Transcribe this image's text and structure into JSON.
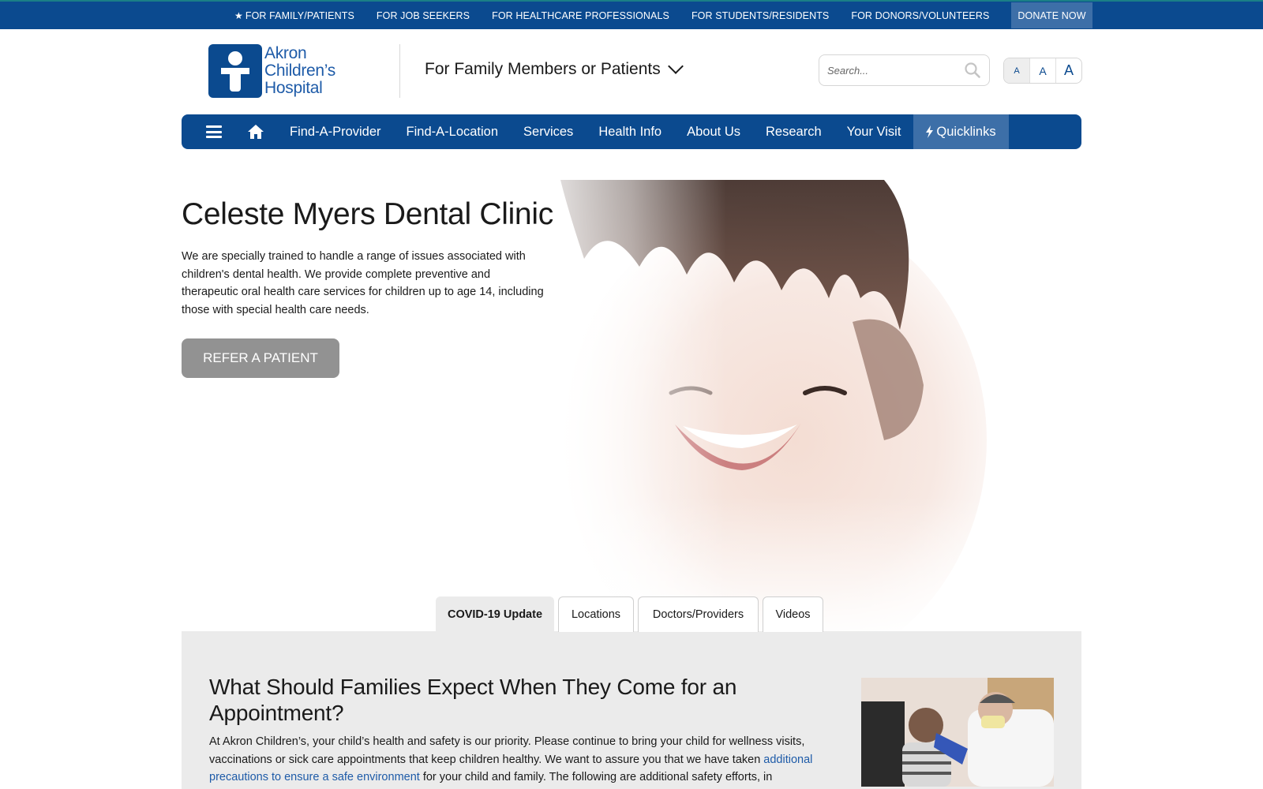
{
  "topbar": {
    "links": [
      {
        "label": "FOR FAMILY/PATIENTS"
      },
      {
        "label": "FOR JOB SEEKERS"
      },
      {
        "label": "FOR HEALTHCARE PROFESSIONALS"
      },
      {
        "label": "FOR STUDENTS/RESIDENTS"
      },
      {
        "label": "FOR DONORS/VOLUNTEERS"
      }
    ],
    "donate_label": "DONATE NOW"
  },
  "logo": {
    "line1": "Akron",
    "line2": "Children’s",
    "line3": "Hospital"
  },
  "audience_selector": {
    "label": "For Family Members or Patients"
  },
  "search": {
    "placeholder": "Search..."
  },
  "text_size": {
    "small": "A",
    "medium": "A",
    "large": "A"
  },
  "nav": {
    "items": [
      {
        "label": "Find-A-Provider"
      },
      {
        "label": "Find-A-Location"
      },
      {
        "label": "Services"
      },
      {
        "label": "Health Info"
      },
      {
        "label": "About Us"
      },
      {
        "label": "Research"
      },
      {
        "label": "Your Visit"
      }
    ],
    "quicklinks_label": "Quicklinks"
  },
  "hero": {
    "title": "Celeste Myers Dental Clinic",
    "description": "We are specially trained to handle a range of issues associated with children's dental health. We provide complete preventive and therapeutic oral health care services for children up to age 14, including those with special health care needs.",
    "cta_label": "REFER A PATIENT"
  },
  "tabs": [
    {
      "label": "COVID-19 Update",
      "active": true
    },
    {
      "label": "Locations",
      "active": false
    },
    {
      "label": "Doctors/Providers",
      "active": false
    },
    {
      "label": "Videos",
      "active": false
    }
  ],
  "panel": {
    "title": "What Should Families Expect When They Come for an Appointment?",
    "text_before": "At Akron Children’s, your child’s health and safety is our priority. Please continue to bring your child for wellness visits, vaccinations or sick care appointments that keep children healthy. We want to assure you that we have taken ",
    "link_text": "additional precautions to ensure a safe environment",
    "text_after": " for your child and family. The following are additional safety efforts, in"
  },
  "colors": {
    "brand_blue": "#0b4a8f",
    "highlight_blue": "#3d6fa8",
    "link_blue": "#1e5ba8",
    "button_gray": "#929292",
    "panel_gray": "#ebebeb"
  }
}
